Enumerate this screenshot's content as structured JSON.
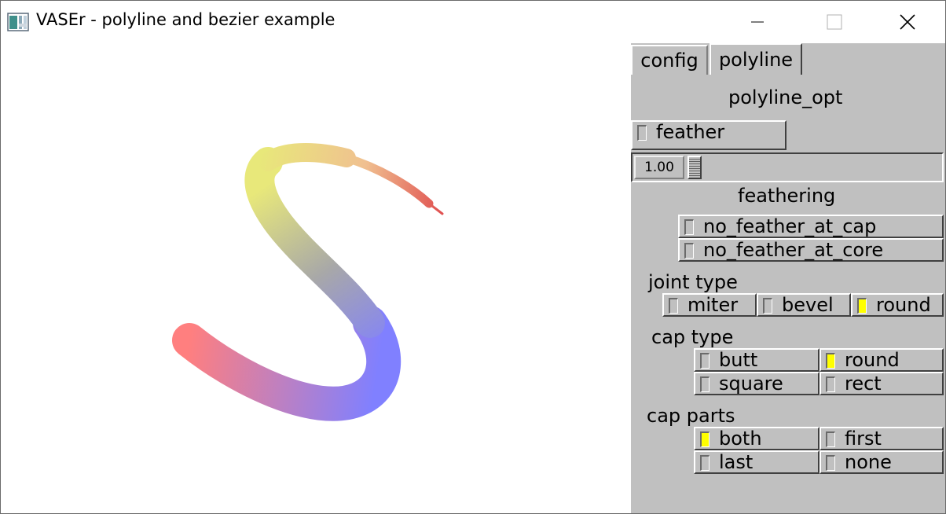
{
  "window": {
    "title": "VASEr - polyline and bezier example",
    "controls": {
      "minimize": "—",
      "maximize": "☐",
      "close": "✕"
    },
    "icon": "app-window-icon"
  },
  "canvas": {
    "stroke": {
      "colors": {
        "start": "#ff7f7f",
        "middle": "#8080ff",
        "s_bend": "#a8a8a8",
        "upper": "#e8e87a",
        "end": "#e05050"
      }
    }
  },
  "panel": {
    "tabs": [
      {
        "label": "config",
        "active": false
      },
      {
        "label": "polyline",
        "active": true
      }
    ],
    "heading": "polyline_opt",
    "feather": {
      "label": "feather",
      "checked": false
    },
    "slider": {
      "value": "1.00"
    },
    "feathering": {
      "heading": "feathering",
      "options": [
        {
          "label": "no_feather_at_cap",
          "checked": false
        },
        {
          "label": "no_feather_at_core",
          "checked": false
        }
      ]
    },
    "joint_type": {
      "heading": "joint type",
      "options": [
        {
          "label": "miter",
          "checked": false
        },
        {
          "label": "bevel",
          "checked": false
        },
        {
          "label": "round",
          "checked": true
        }
      ]
    },
    "cap_type": {
      "heading": "cap type",
      "options": [
        {
          "label": "butt",
          "checked": false
        },
        {
          "label": "round",
          "checked": true
        },
        {
          "label": "square",
          "checked": false
        },
        {
          "label": "rect",
          "checked": false
        }
      ]
    },
    "cap_parts": {
      "heading": "cap parts",
      "options": [
        {
          "label": "both",
          "checked": true
        },
        {
          "label": "first",
          "checked": false
        },
        {
          "label": "last",
          "checked": false
        },
        {
          "label": "none",
          "checked": false
        }
      ]
    }
  }
}
